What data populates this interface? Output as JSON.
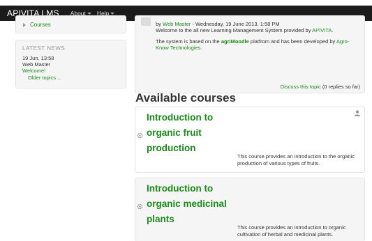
{
  "navbar": {
    "brand": "APIVITA LMS",
    "menus": [
      "About",
      "Help"
    ],
    "background": "#1b1b1b"
  },
  "sidebar": {
    "courses_link": "Courses",
    "latest_news": {
      "title": "LATEST NEWS",
      "date": "19 Jun, 13:58",
      "author": "Web Master",
      "item": "Welcome!",
      "older": "Older topics ..."
    }
  },
  "post": {
    "by": "by",
    "author": "Web Master",
    "date": "- Wednesday, 19 June 2013, 1:58 PM",
    "line1_prefix": "Welcome to the all new Learning Management System provided by",
    "line1_link": "APIVITA.",
    "line2_prefix": "The system is based on the",
    "line2_bold": "agriMoodle",
    "line2_suffix": "platfrom and has been developed by",
    "line2_link": "Agro-",
    "line3_link": "Know Technologies.",
    "discuss_link": "Discuss this topic",
    "discuss_count": "(0 replies so far)"
  },
  "available": {
    "heading": "Available courses",
    "courses": [
      {
        "title_lines": [
          "Introduction to",
          "organic fruit",
          "production"
        ],
        "desc_lines": [
          "This course provides an introduction to the organic",
          "production of various types of fruits."
        ]
      },
      {
        "title_lines": [
          "Introduction to",
          "organic medicinal",
          "plants"
        ],
        "desc_lines": [
          "This course provides an introduction to organic",
          "cultivation of herbal and medicinal plants."
        ]
      }
    ]
  },
  "colors": {
    "link_green": "#1a8a1a",
    "panel_bg": "#f5f5f5",
    "panel_border": "#e3e3e3"
  },
  "icons": [
    "course-gear-icon",
    "user-icon",
    "caret-down-icon",
    "triangle-right-icon"
  ]
}
